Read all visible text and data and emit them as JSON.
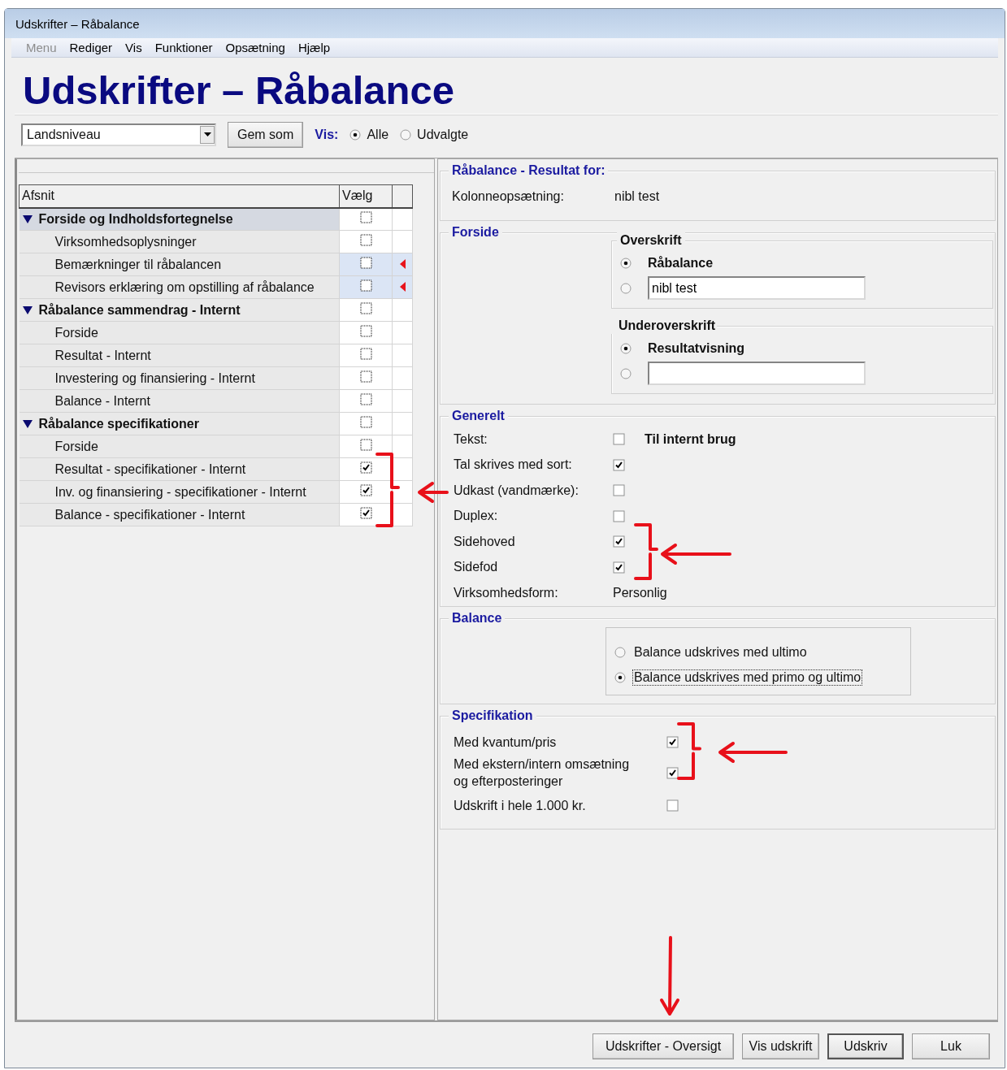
{
  "window": {
    "title": "Udskrifter – Råbalance"
  },
  "menu": [
    {
      "label": "Menu",
      "disabled": true
    },
    {
      "label": "Rediger",
      "disabled": false
    },
    {
      "label": "Vis",
      "disabled": false
    },
    {
      "label": "Funktioner",
      "disabled": false
    },
    {
      "label": "Opsætning",
      "disabled": false
    },
    {
      "label": "Hjælp",
      "disabled": false
    }
  ],
  "heading": "Udskrifter – Råbalance",
  "toolbar": {
    "dropdown": "Landsniveau",
    "save_button": "Gem som",
    "show_label": "Vis:",
    "show_options": [
      {
        "label": "Alle",
        "selected": true
      },
      {
        "label": "Udvalgte",
        "selected": false
      }
    ]
  },
  "sections_table": {
    "columns": [
      "Afsnit",
      "Vælg"
    ],
    "groups": [
      {
        "label": "Forside og Indholdsfortegnelse",
        "expanded": true,
        "selected": true,
        "checked": false,
        "children": [
          {
            "label": "Virksomhedsoplysninger",
            "selected": false,
            "checked": false,
            "flagged": false
          },
          {
            "label": "Bemærkninger til råbalancen",
            "selected": false,
            "checked": false,
            "flagged": true
          },
          {
            "label": "Revisors erklæring om opstilling af råbalance",
            "selected": false,
            "checked": false,
            "flagged": true
          }
        ]
      },
      {
        "label": "Råbalance sammendrag - Internt",
        "expanded": true,
        "selected": false,
        "checked": false,
        "children": [
          {
            "label": "Forside",
            "selected": false,
            "checked": false,
            "flagged": false
          },
          {
            "label": "Resultat - Internt",
            "selected": false,
            "checked": false,
            "flagged": false
          },
          {
            "label": "Investering og finansiering - Internt",
            "selected": false,
            "checked": false,
            "flagged": false
          },
          {
            "label": "Balance - Internt",
            "selected": false,
            "checked": false,
            "flagged": false
          }
        ]
      },
      {
        "label": "Råbalance specifikationer",
        "expanded": true,
        "selected": false,
        "checked": false,
        "children": [
          {
            "label": "Forside",
            "selected": false,
            "checked": false,
            "flagged": false
          },
          {
            "label": "Resultat - specifikationer - Internt",
            "selected": false,
            "checked": true,
            "flagged": false
          },
          {
            "label": "Inv. og finansiering - specifikationer - Internt",
            "selected": false,
            "checked": true,
            "flagged": false
          },
          {
            "label": "Balance - specifikationer - Internt",
            "selected": false,
            "checked": true,
            "flagged": false
          }
        ]
      }
    ]
  },
  "result_for": {
    "title": "Råbalance - Resultat for:",
    "rows": [
      {
        "label": "Kolonneopsætning:",
        "value": "nibl test"
      }
    ]
  },
  "forside": {
    "title": "Forside",
    "groups": [
      {
        "title": "Overskrift",
        "options": [
          {
            "kind": "label",
            "label": "Råbalance",
            "selected": true
          },
          {
            "kind": "field",
            "value": "nibl test",
            "selected": false
          }
        ]
      },
      {
        "title": "Underoverskrift",
        "options": [
          {
            "kind": "label",
            "label": "Resultatvisning",
            "selected": true
          },
          {
            "kind": "field",
            "selected": false
          }
        ]
      }
    ]
  },
  "generelt": {
    "title": "Generelt",
    "rows": [
      {
        "kind": "checkbox",
        "label": "Tekst:",
        "checked": false,
        "note": "Til internt brug"
      },
      {
        "kind": "checkbox",
        "label": "Tal skrives med sort:",
        "checked": true
      },
      {
        "kind": "checkbox",
        "label": "Udkast (vandmærke):",
        "checked": false
      },
      {
        "kind": "checkbox",
        "label": "Duplex:",
        "checked": false
      },
      {
        "kind": "checkbox",
        "label": "Sidehoved",
        "checked": true
      },
      {
        "kind": "checkbox",
        "label": "Sidefod",
        "checked": true
      },
      {
        "kind": "value",
        "label": "Virksomhedsform:",
        "value": "Personlig"
      }
    ]
  },
  "balance": {
    "title": "Balance",
    "options": [
      {
        "label": "Balance udskrives med ultimo",
        "selected": false
      },
      {
        "label": "Balance udskrives med primo og ultimo",
        "selected": true
      }
    ]
  },
  "specifikation": {
    "title": "Specifikation",
    "rows": [
      {
        "label": "Med kvantum/pris",
        "checked": true
      },
      {
        "label": "Med ekstern/intern omsætning\nog efterposteringer",
        "checked": true
      },
      {
        "label": "Udskrift i hele 1.000 kr.",
        "checked": false
      }
    ]
  },
  "buttons": [
    {
      "label": "Udskrifter - Oversigt",
      "default": false
    },
    {
      "label": "Vis udskrift",
      "default": false
    },
    {
      "label": "Udskriv",
      "default": true
    },
    {
      "label": "Luk",
      "default": false
    }
  ]
}
